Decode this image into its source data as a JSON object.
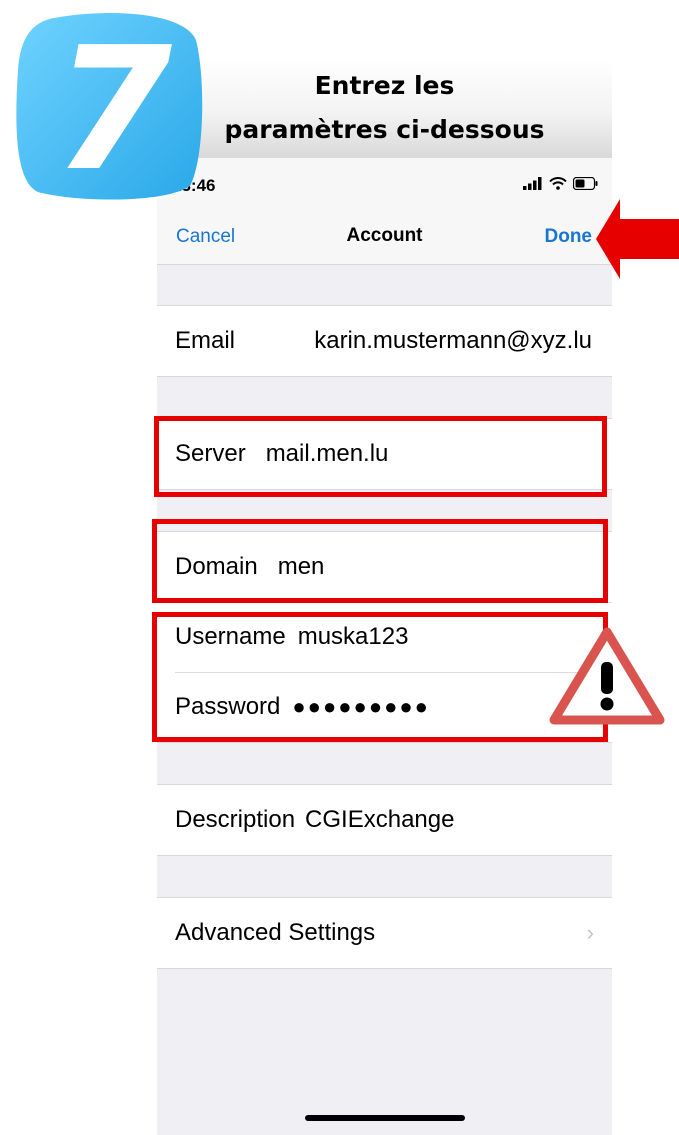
{
  "step": {
    "number": "7",
    "color": "#4fc3f7"
  },
  "instruction": {
    "line1": "Entrez les",
    "line2": "paramètres ci-dessous"
  },
  "status_bar": {
    "time": "13:46",
    "icons": [
      "signal-icon",
      "wifi-icon",
      "battery-icon"
    ]
  },
  "navbar": {
    "cancel_label": "Cancel",
    "title": "Account",
    "done_label": "Done"
  },
  "fields": {
    "email": {
      "label": "Email",
      "value": "karin.mustermann@xyz.lu"
    },
    "server": {
      "label": "Server",
      "value": "mail.men.lu"
    },
    "domain": {
      "label": "Domain",
      "value": "men"
    },
    "username": {
      "label": "Username",
      "value": "muska123"
    },
    "password": {
      "label": "Password",
      "value": "●●●●●●●●●"
    },
    "description": {
      "label": "Description",
      "value": "CGIExchange"
    }
  },
  "advanced": {
    "label": "Advanced Settings",
    "chevron": "›"
  },
  "colors": {
    "accent": "#1876d2",
    "highlight": "#e60000",
    "background": "#f0eff4"
  }
}
